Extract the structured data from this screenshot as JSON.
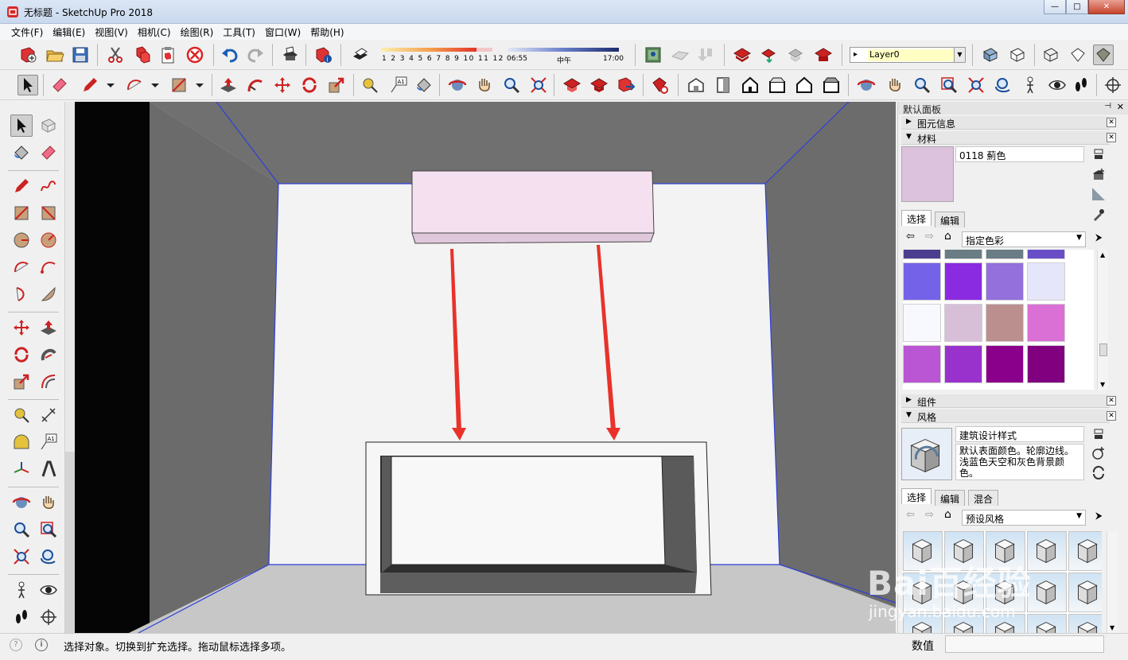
{
  "window": {
    "title": "无标题 - SketchUp Pro 2018",
    "minimize": "—",
    "maximize": "□",
    "close": "✕"
  },
  "menu": [
    "文件(F)",
    "编辑(E)",
    "视图(V)",
    "相机(C)",
    "绘图(R)",
    "工具(T)",
    "窗口(W)",
    "帮助(H)"
  ],
  "toolbar": {
    "shadow_scale_numbers": "1 2 3 4 5 6 7 8 9 10 11 12",
    "time_start": "06:55",
    "time_mid": "中午",
    "time_end": "17:00",
    "layer_name": "Layer0"
  },
  "tray": {
    "title": "默认面板",
    "pin": "⊣",
    "close": "✕",
    "sections": {
      "entity_info": "图元信息",
      "materials": "材料",
      "components": "组件",
      "styles": "风格"
    },
    "materials": {
      "current_name": "0118 薊色",
      "current_color": "#dcc2dc",
      "tabs": [
        "选择",
        "编辑"
      ],
      "collection": "指定色彩",
      "swatches": [
        "#4c3e8e",
        "#6a7c84",
        "#6a7c84",
        "#6a4ec8",
        "#7463e8",
        "#8a2be2",
        "#9370db",
        "#e6e6fa",
        "#f8f8ff",
        "#d8bfd8",
        "#bc8f8f",
        "#da70d6",
        "#ba55d3",
        "#9932cc",
        "#8b008b",
        "#800080"
      ]
    },
    "styles": {
      "current_name": "建筑设计样式",
      "description": "默认表面颜色。轮廓边线。浅蓝色天空和灰色背景颜色。",
      "tabs": [
        "选择",
        "编辑",
        "混合"
      ],
      "collection": "预设风格"
    }
  },
  "status": {
    "message": "选择对象。切换到扩充选择。拖动鼠标选择多项。",
    "value_label": "数值",
    "value": ""
  },
  "watermark": {
    "logo": "Bai百经验",
    "url": "jingyan.baidu.com"
  },
  "colors": {
    "accent_red": "#e8322a",
    "selection_blue": "#2d3fd8",
    "ac_unit_pink": "#f5e0f0"
  }
}
